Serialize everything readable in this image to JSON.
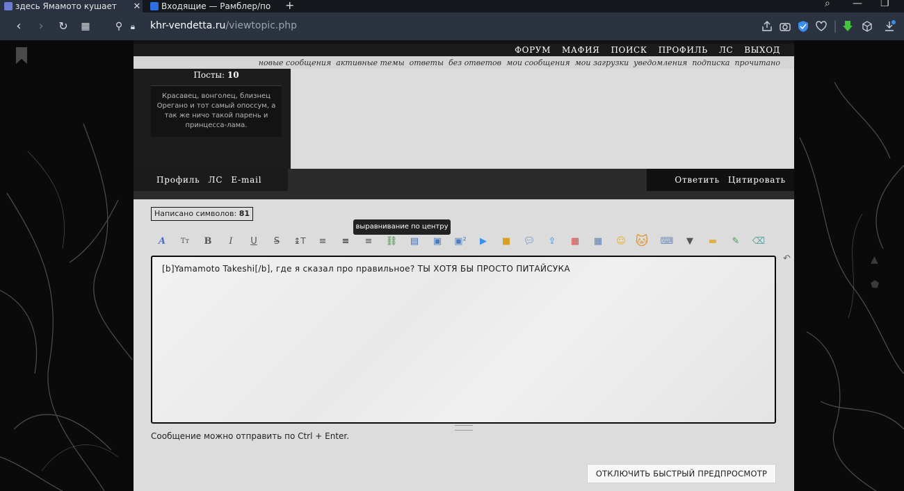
{
  "browser": {
    "tabs": [
      {
        "title": "здесь Ямамото кушает",
        "active": true
      },
      {
        "title": "Входящие — Рамблер/по",
        "active": false
      }
    ],
    "new_tab": "+",
    "url_host": "khr-vendetta.ru",
    "url_path": "/viewtopic.php"
  },
  "forum": {
    "main_nav": [
      "ФОРУМ",
      "МАФИЯ",
      "ПОИСК",
      "ПРОФИЛЬ",
      "ЛС",
      "ВЫХОД"
    ],
    "sub_nav": [
      "новые сообщения",
      "активные темы",
      "ответы",
      "без ответов",
      "мои сообщения",
      "мои загрузки",
      "уведомления",
      "подписка",
      "прочитано"
    ],
    "profile": {
      "posts_label": "Посты:",
      "posts_count": "10",
      "bio": "Красавец, вонголец, близнец Орегано и тот самый опоссум, а так же ничо такой парень и принцесса-лама."
    },
    "post_links_left": [
      "Профиль",
      "ЛС",
      "E-mail"
    ],
    "post_links_right": [
      "Ответить",
      "Цитировать"
    ],
    "editor": {
      "chars_label": "Написано символов:",
      "chars_count": "81",
      "tooltip": "выравнивание по центру",
      "text": "[b]Yamamoto Takeshi[/b], где я сказал про правильное? ТЫ ХОТЯ БЫ ПРОСТО ПИТАЙСУКА",
      "hint": "Сообщение можно отправить по Ctrl + Enter.",
      "preview_button": "ОТКЛЮЧИТЬ БЫСТРЫЙ ПРЕДПРОСМОТР"
    },
    "toolbar_icons": [
      "font-icon",
      "font-size-icon",
      "bold-icon",
      "italic-icon",
      "underline-icon",
      "strike-icon",
      "line-height-icon",
      "align-left-icon",
      "align-center-icon",
      "align-right-icon",
      "link-icon",
      "book-icon",
      "image-icon",
      "gallery-icon",
      "video-icon",
      "lock-icon",
      "speech-icon",
      "upload-icon",
      "color-icon",
      "table-icon",
      "smile-icon",
      "cat-icon",
      "keyboard-icon",
      "dropdown-icon",
      "folder-icon",
      "edit-icon",
      "clear-icon"
    ]
  }
}
